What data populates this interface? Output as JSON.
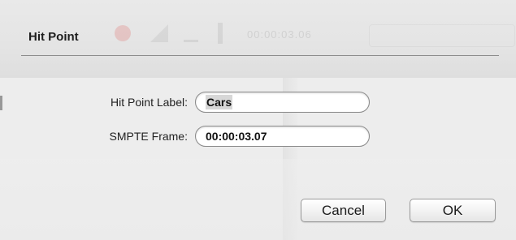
{
  "dialog": {
    "title": "Hit Point"
  },
  "background": {
    "timecode_ghost": "00:00:03.06"
  },
  "fields": {
    "hit_point_label": {
      "label": "Hit Point Label:",
      "value": "Cars"
    },
    "smpte_frame": {
      "label": "SMPTE Frame:",
      "value": "00:00:03.07"
    }
  },
  "buttons": {
    "cancel_label": "Cancel",
    "ok_label": "OK"
  }
}
